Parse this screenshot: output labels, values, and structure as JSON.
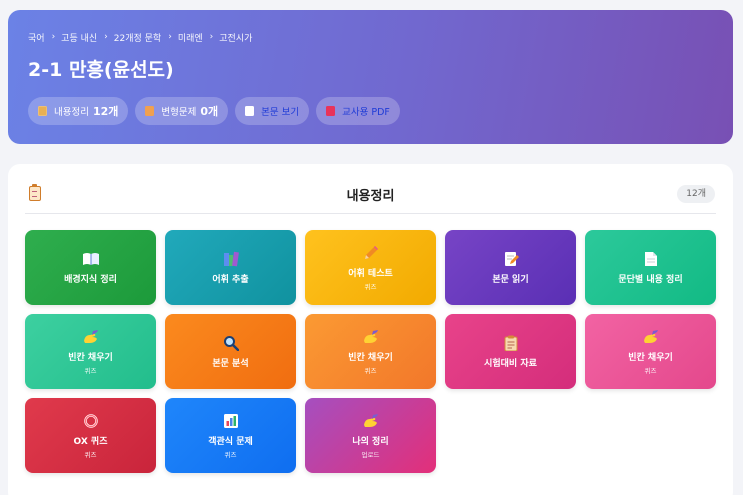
{
  "header": {
    "breadcrumb": [
      "국어",
      "고등 내신",
      "22개정 문학",
      "미래엔",
      "고전시가"
    ],
    "breadcrumb_separator": "›",
    "title": "2-1 만흥(윤선도)",
    "chips": [
      {
        "icon": "content-summary-icon",
        "label": "내용정리",
        "count": "12개"
      },
      {
        "icon": "variant-problem-icon",
        "label": "변형문제",
        "count": "0개"
      },
      {
        "icon": "document-icon",
        "label": "본문 보기"
      },
      {
        "icon": "book-icon",
        "label": "교사용 PDF"
      }
    ]
  },
  "section": {
    "icon": "clipboard-icon",
    "title": "내용정리",
    "count": "12개"
  },
  "cards": [
    {
      "icon": "book-icon",
      "label": "배경지식 정리",
      "sub": "",
      "colors": [
        "#2fae4e",
        "#1c9a3a"
      ]
    },
    {
      "icon": "books-icon",
      "label": "어휘 추출",
      "sub": "",
      "colors": [
        "#21a9bb",
        "#10929f"
      ]
    },
    {
      "icon": "pencil-icon",
      "label": "어휘 테스트",
      "sub": "퀴즈",
      "colors": [
        "#ffc21e",
        "#f2aa00"
      ]
    },
    {
      "icon": "write-document-icon",
      "label": "본문 읽기",
      "sub": "",
      "colors": [
        "#7744c6",
        "#5a2fb4"
      ]
    },
    {
      "icon": "document-icon",
      "label": "문단별 내용 정리",
      "sub": "",
      "colors": [
        "#2cc99b",
        "#12ba84"
      ]
    },
    {
      "icon": "writing-hand-icon",
      "label": "빈칸 채우기",
      "sub": "퀴즈",
      "colors": [
        "#3dd0a0",
        "#22bd8c"
      ]
    },
    {
      "icon": "magnifier-icon",
      "label": "본문 분석",
      "sub": "",
      "colors": [
        "#fb8a1e",
        "#f06d10"
      ]
    },
    {
      "icon": "writing-hand-icon",
      "label": "빈칸 채우기",
      "sub": "퀴즈",
      "colors": [
        "#fb9a33",
        "#f2772a"
      ]
    },
    {
      "icon": "clipboard-icon",
      "label": "시험대비 자료",
      "sub": "",
      "colors": [
        "#e8438a",
        "#d42d7b"
      ]
    },
    {
      "icon": "writing-hand-icon",
      "label": "빈칸 채우기",
      "sub": "퀴즈",
      "colors": [
        "#f263a3",
        "#e4488c"
      ]
    },
    {
      "icon": "ring-icon",
      "label": "OX 퀴즈",
      "sub": "퀴즈",
      "colors": [
        "#e03a4c",
        "#c9243b"
      ]
    },
    {
      "icon": "bar-chart-icon",
      "label": "객관식 문제",
      "sub": "퀴즈",
      "colors": [
        "#1f86fb",
        "#0f6ef0"
      ]
    },
    {
      "icon": "writing-hand-icon",
      "label": "나의 정리",
      "sub": "업로드",
      "colors": [
        "#a54fc0",
        "#e32f79"
      ]
    }
  ]
}
